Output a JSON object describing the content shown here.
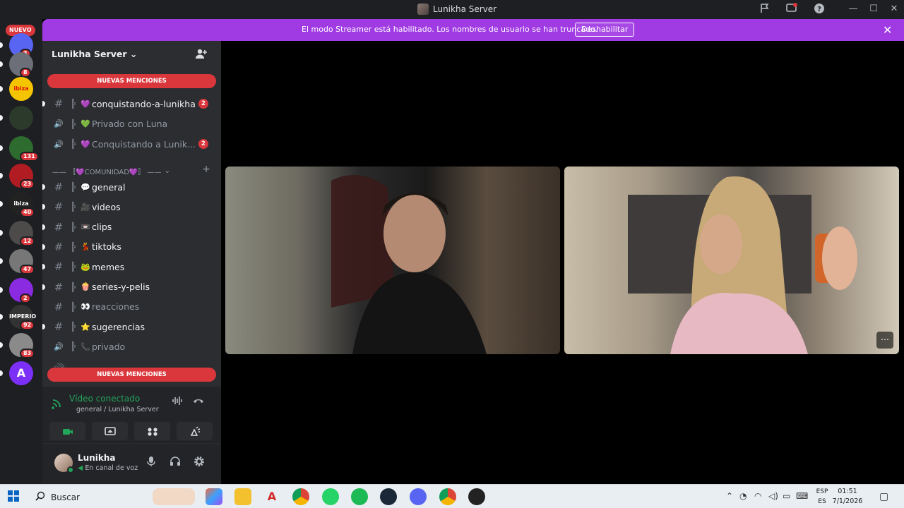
{
  "window": {
    "title": "Lunikha Server"
  },
  "banner": {
    "message": "El modo Streamer está habilitado. Los nombres de usuario se han truncado.",
    "button_label": "Deshabilitar"
  },
  "rail": {
    "new_label": "NUEVO",
    "server_icons": [
      {
        "name": "server-1",
        "badge": "3",
        "color": "#5865f2"
      },
      {
        "name": "server-2",
        "badge": "8",
        "color": "#6d6f78"
      },
      {
        "name": "ibiza",
        "badge": "",
        "color": "#f5c400",
        "label": "ibiza"
      },
      {
        "name": "leaf",
        "badge": "",
        "color": "#2b3a2b"
      },
      {
        "name": "frog",
        "badge": "131",
        "color": "#2d6b2f"
      },
      {
        "name": "lips",
        "badge": "23",
        "color": "#b11c22"
      },
      {
        "name": "ibiza-dark",
        "badge": "40",
        "color": "#222222",
        "label": "ibiza"
      },
      {
        "name": "server-8",
        "badge": "12",
        "color": "#4d4a4a"
      },
      {
        "name": "server-9",
        "badge": "47",
        "color": "#777777"
      },
      {
        "name": "gem",
        "badge": "2",
        "color": "#8a2be2"
      },
      {
        "name": "imperio",
        "badge": "92",
        "color": "#333333",
        "label": "IMPERIO"
      },
      {
        "name": "server-12",
        "badge": "83",
        "color": "#8a8a8a"
      },
      {
        "name": "letter-a",
        "badge": "",
        "color": "#7b2ff7",
        "label": "A"
      }
    ]
  },
  "sidebar": {
    "server_name": "Lunikha Server",
    "mentions_label": "NUEVAS MENCIONES",
    "channels_top": [
      {
        "icon": "hashtag-icon",
        "emoji": "💜",
        "label": "conquistando-a-lunikha",
        "count": "2",
        "unread": true
      },
      {
        "icon": "speaker-icon",
        "emoji": "💚",
        "label": "Privado con Luna",
        "count": "",
        "unread": false,
        "dim": true
      },
      {
        "icon": "speaker-icon",
        "emoji": "💜",
        "label": "Conquistando a Lunik...",
        "count": "2",
        "unread": false,
        "dim": true
      }
    ],
    "category": "—— 〚💜COMUNIDAD💜〛 ——",
    "channels": [
      {
        "icon": "hashtag-icon",
        "emoji": "💬",
        "label": "general",
        "unread": true
      },
      {
        "icon": "hashtag-icon",
        "emoji": "🎥",
        "label": "videos",
        "unread": true
      },
      {
        "icon": "hashtag-icon",
        "emoji": "📼",
        "label": "clips",
        "unread": true
      },
      {
        "icon": "hashtag-icon",
        "emoji": "💃",
        "label": "tiktoks",
        "unread": true
      },
      {
        "icon": "hashtag-icon",
        "emoji": "🐸",
        "label": "memes",
        "unread": true
      },
      {
        "icon": "hashtag-icon",
        "emoji": "🍿",
        "label": "series-y-pelis",
        "unread": true
      },
      {
        "icon": "hashtag-icon",
        "emoji": "👀",
        "label": "reacciones",
        "unread": false,
        "dim": true
      },
      {
        "icon": "hashtag-icon",
        "emoji": "⭐",
        "label": "sugerencias",
        "unread": true
      },
      {
        "icon": "speaker-icon",
        "emoji": "📞",
        "label": "privado",
        "unread": false,
        "dim": true
      }
    ],
    "voice": {
      "status": "Vídeo conectado",
      "channel": "general / Lunikha Server"
    },
    "user": {
      "name": "Lunikha",
      "status": "En canal de voz"
    }
  },
  "taskbar": {
    "search_placeholder": "Buscar",
    "lang_top": "ESP",
    "lang_bottom": "ES",
    "time": "01:51",
    "date": "7/1/2026"
  }
}
